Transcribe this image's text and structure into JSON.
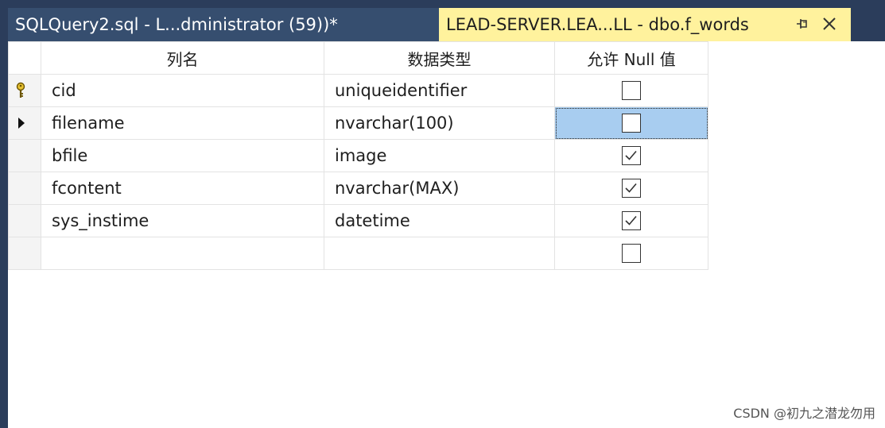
{
  "tabs": [
    {
      "label": "SQLQuery2.sql - L...dministrator (59))*"
    },
    {
      "label": "LEAD-SERVER.LEA...LL - dbo.f_words"
    }
  ],
  "icons": {
    "pin": "pin-icon",
    "close": "close-icon",
    "primary_key": "key-icon",
    "current_row": "arrow-icon"
  },
  "grid": {
    "headers": [
      "列名",
      "数据类型",
      "允许 Null 值"
    ],
    "rows": [
      {
        "column": "cid",
        "type": "uniqueidentifier",
        "allow_null": false,
        "primary_key": true
      },
      {
        "column": "filename",
        "type": "nvarchar(100)",
        "allow_null": false,
        "current": true
      },
      {
        "column": "bfile",
        "type": "image",
        "allow_null": true
      },
      {
        "column": "fcontent",
        "type": "nvarchar(MAX)",
        "allow_null": true
      },
      {
        "column": "sys_instime",
        "type": "datetime",
        "allow_null": true
      },
      {
        "column": "",
        "type": "",
        "allow_null": false
      }
    ]
  },
  "watermark": "CSDN @初九之潜龙勿用",
  "colors": {
    "accent_tab": "#fff29d",
    "frame": "#2b3d5b",
    "selection": "#a8cdf0"
  }
}
